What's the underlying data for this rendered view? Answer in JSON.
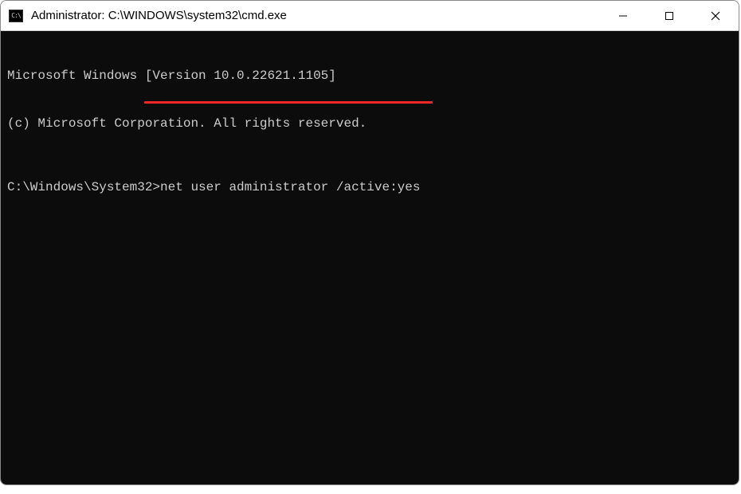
{
  "titlebar": {
    "icon_label": "C:\\",
    "title": "Administrator: C:\\WINDOWS\\system32\\cmd.exe"
  },
  "terminal": {
    "line1": "Microsoft Windows [Version 10.0.22621.1105]",
    "line2": "(c) Microsoft Corporation. All rights reserved.",
    "prompt": "C:\\Windows\\System32>",
    "command": "net user administrator /active:yes"
  },
  "annotation": {
    "color": "#ed2828"
  }
}
